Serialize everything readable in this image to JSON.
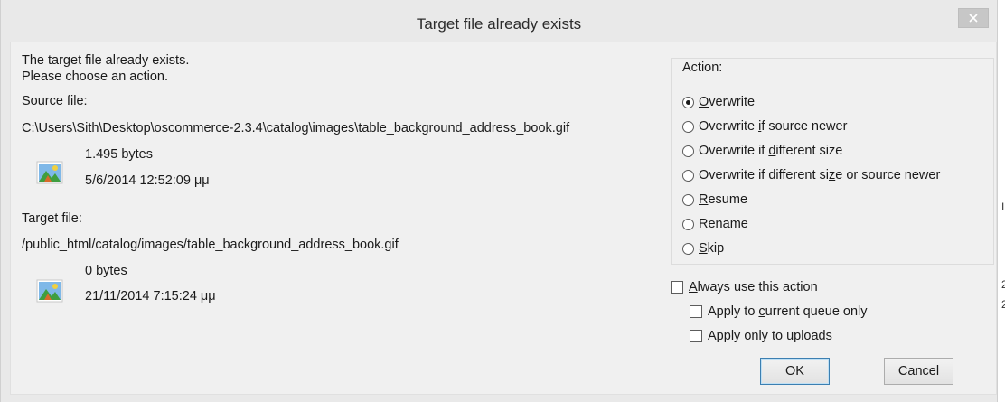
{
  "dialog": {
    "title": "Target file already exists",
    "intro_line1": "The target file already exists.",
    "intro_line2": "Please choose an action."
  },
  "source": {
    "label": "Source file:",
    "path": "C:\\Users\\Sith\\Desktop\\oscommerce-2.3.4\\catalog\\images\\table_background_address_book.gif",
    "size": "1.495 bytes",
    "date": "5/6/2014 12:52:09 μμ"
  },
  "target": {
    "label": "Target file:",
    "path": "/public_html/catalog/images/table_background_address_book.gif",
    "size": "0 bytes",
    "date": "21/11/2014 7:15:24 μμ"
  },
  "action": {
    "label": "Action:",
    "selected": "Overwrite",
    "options": [
      {
        "pre": "",
        "key": "O",
        "post": "verwrite"
      },
      {
        "pre": "Overwrite ",
        "key": "i",
        "post": "f source newer"
      },
      {
        "pre": "Overwrite if ",
        "key": "d",
        "post": "ifferent size"
      },
      {
        "pre": "Overwrite if different si",
        "key": "z",
        "post": "e or source newer"
      },
      {
        "pre": "",
        "key": "R",
        "post": "esume"
      },
      {
        "pre": "Re",
        "key": "n",
        "post": "ame"
      },
      {
        "pre": "",
        "key": "S",
        "post": "kip"
      }
    ]
  },
  "checks": {
    "always": {
      "pre": "",
      "key": "A",
      "post": "lways use this action"
    },
    "queue": {
      "pre": "Apply to ",
      "key": "c",
      "post": "urrent queue only"
    },
    "uploads": {
      "pre": "A",
      "key": "p",
      "post": "ply only to uploads"
    }
  },
  "buttons": {
    "ok": "OK",
    "cancel": "Cancel"
  },
  "edge_glyphs": [
    "I",
    "2",
    "2"
  ]
}
